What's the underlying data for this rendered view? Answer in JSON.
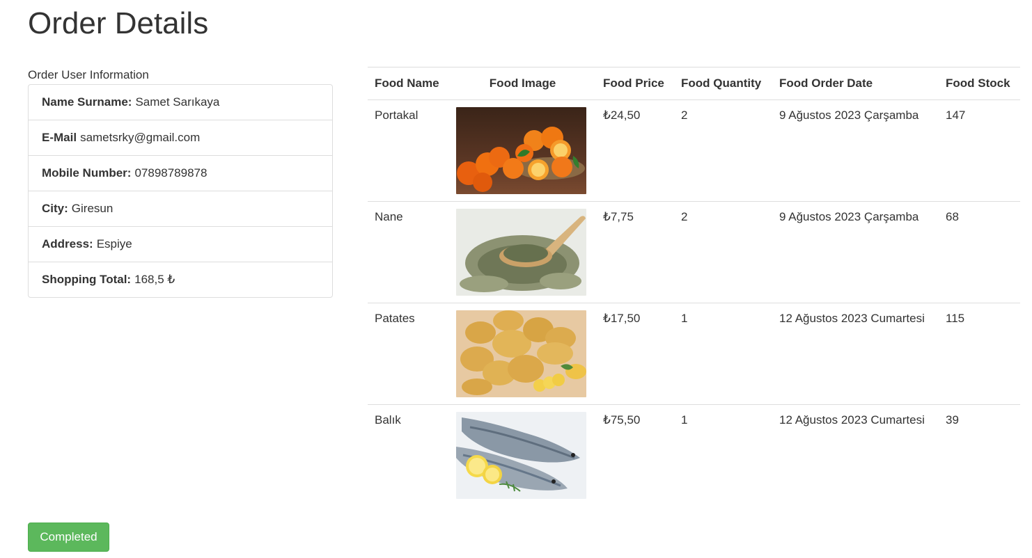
{
  "page": {
    "title": "Order Details"
  },
  "user_info": {
    "heading": "Order User Information",
    "fields": [
      {
        "label": "Name Surname:",
        "value": "Samet Sarıkaya"
      },
      {
        "label": "E-Mail",
        "value": "sametsrky@gmail.com"
      },
      {
        "label": "Mobile Number:",
        "value": "07898789878"
      },
      {
        "label": "City:",
        "value": "Giresun"
      },
      {
        "label": "Address:",
        "value": "Espiye"
      },
      {
        "label": "Shopping Total:",
        "value": "168,5 ₺"
      }
    ]
  },
  "table": {
    "headers": [
      "Food Name",
      "Food Image",
      "Food Price",
      "Food Quantity",
      "Food Order Date",
      "Food Stock"
    ],
    "rows": [
      {
        "name": "Portakal",
        "image_icon": "oranges-image",
        "price": "₺24,50",
        "quantity": "2",
        "date": "9 Ağustos 2023 Çarşamba",
        "stock": "147"
      },
      {
        "name": "Nane",
        "image_icon": "dried-mint-image",
        "price": "₺7,75",
        "quantity": "2",
        "date": "9 Ağustos 2023 Çarşamba",
        "stock": "68"
      },
      {
        "name": "Patates",
        "image_icon": "potatoes-image",
        "price": "₺17,50",
        "quantity": "1",
        "date": "12 Ağustos 2023 Cumartesi",
        "stock": "115"
      },
      {
        "name": "Balık",
        "image_icon": "fish-image",
        "price": "₺75,50",
        "quantity": "1",
        "date": "12 Ağustos 2023 Cumartesi",
        "stock": "39"
      }
    ]
  },
  "actions": {
    "complete_label": "Completed",
    "complete_color": "#5cb85c"
  }
}
